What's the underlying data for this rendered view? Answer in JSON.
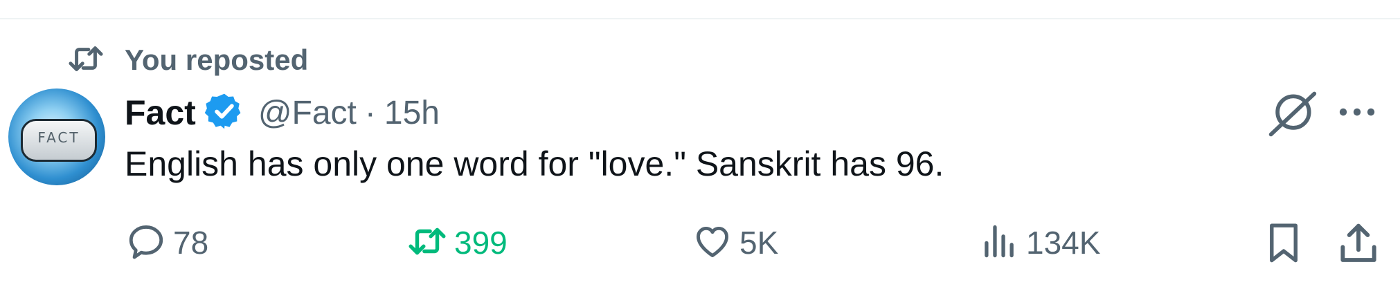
{
  "repost_context": {
    "label": "You reposted",
    "icon": "repost-icon"
  },
  "author": {
    "name": "Fact",
    "handle": "@Fact",
    "time": "15h",
    "separator": "·",
    "verified": true,
    "avatar_text": "FACT",
    "verified_color": "#1d9bf0"
  },
  "tweet": {
    "text": "English has only one word for \"love.\" Sanskrit has 96."
  },
  "actions": {
    "reply": {
      "count": "78",
      "icon": "reply-icon"
    },
    "repost": {
      "count": "399",
      "icon": "repost-icon",
      "active": true,
      "color": "#00ba7c"
    },
    "like": {
      "count": "5K",
      "icon": "heart-icon"
    },
    "views": {
      "count": "134K",
      "icon": "views-icon"
    },
    "bookmark": {
      "icon": "bookmark-icon"
    },
    "share": {
      "icon": "share-icon"
    }
  },
  "header_icons": {
    "grok": "grok-icon",
    "more": "more-icon"
  }
}
